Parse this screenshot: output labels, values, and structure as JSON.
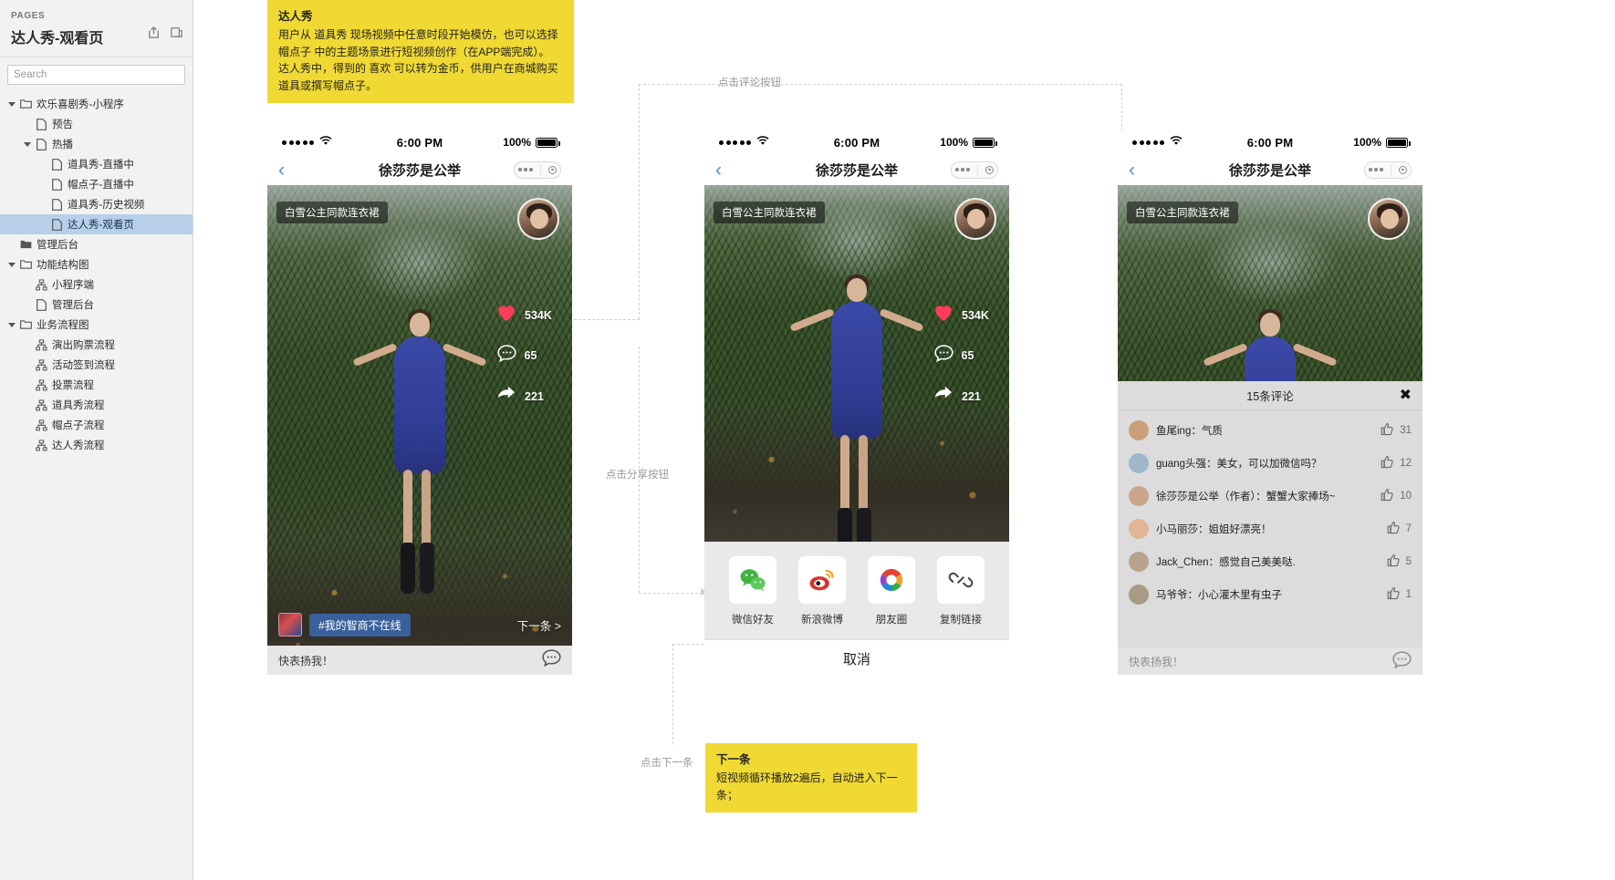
{
  "sidebar": {
    "pages_label": "PAGES",
    "title": "达人秀-观看页",
    "icons": [
      "share-icon",
      "duplicate-icon"
    ],
    "search_placeholder": "Search",
    "tree": [
      {
        "label": "欢乐喜剧秀-小程序",
        "depth": 0,
        "icon": "folder",
        "caret": "down",
        "selected": false
      },
      {
        "label": "预告",
        "depth": 1,
        "icon": "page",
        "caret": "none",
        "selected": false
      },
      {
        "label": "热播",
        "depth": 1,
        "icon": "page",
        "caret": "down",
        "selected": false
      },
      {
        "label": "道具秀-直播中",
        "depth": 2,
        "icon": "page",
        "caret": "none",
        "selected": false
      },
      {
        "label": "帽点子-直播中",
        "depth": 2,
        "icon": "page",
        "caret": "none",
        "selected": false
      },
      {
        "label": "道具秀-历史视频",
        "depth": 2,
        "icon": "page",
        "caret": "none",
        "selected": false
      },
      {
        "label": "达人秀-观看页",
        "depth": 2,
        "icon": "page",
        "caret": "none",
        "selected": true
      },
      {
        "label": "管理后台",
        "depth": 0,
        "icon": "folder-solid",
        "caret": "none",
        "selected": false
      },
      {
        "label": "功能结构图",
        "depth": 0,
        "icon": "folder",
        "caret": "down",
        "selected": false
      },
      {
        "label": "小程序端",
        "depth": 1,
        "icon": "flow",
        "caret": "none",
        "selected": false
      },
      {
        "label": "管理后台",
        "depth": 1,
        "icon": "page",
        "caret": "none",
        "selected": false
      },
      {
        "label": "业务流程图",
        "depth": 0,
        "icon": "folder",
        "caret": "down",
        "selected": false
      },
      {
        "label": "演出购票流程",
        "depth": 1,
        "icon": "flow",
        "caret": "none",
        "selected": false
      },
      {
        "label": "活动签到流程",
        "depth": 1,
        "icon": "flow",
        "caret": "none",
        "selected": false
      },
      {
        "label": "投票流程",
        "depth": 1,
        "icon": "flow",
        "caret": "none",
        "selected": false
      },
      {
        "label": "道具秀流程",
        "depth": 1,
        "icon": "flow",
        "caret": "none",
        "selected": false
      },
      {
        "label": "帽点子流程",
        "depth": 1,
        "icon": "flow",
        "caret": "none",
        "selected": false
      },
      {
        "label": "达人秀流程",
        "depth": 1,
        "icon": "flow",
        "caret": "none",
        "selected": false
      }
    ]
  },
  "notes": {
    "top": {
      "title": "达人秀",
      "body": "用户从 道具秀 现场视频中任意时段开始模仿，也可以选择 帽点子 中的主题场景进行短视频创作（在APP端完成）。\n达人秀中，得到的 喜欢 可以转为金币，供用户在商城购买道具或撰写帽点子。"
    },
    "bottom": {
      "title": "下一条",
      "body": "短视频循环播放2遍后，自动进入下一条；"
    }
  },
  "connectors": {
    "comment": "点击评论按钮",
    "share": "点击分享按钮",
    "next": "点击下一条"
  },
  "status_bar": {
    "time": "6:00 PM",
    "battery_pct": "100%",
    "signal_icon": "signal-dots-icon",
    "wifi_icon": "wifi-icon",
    "battery_icon": "battery-icon"
  },
  "nav": {
    "back_icon": "chevron-left-icon",
    "title": "徐莎莎是公举",
    "capsule_icon": "mini-program-capsule"
  },
  "video": {
    "product_tag": "白雪公主同款连衣裙",
    "avatar": "author-avatar",
    "actions": [
      {
        "icon": "heart-icon",
        "count": "534K",
        "name": "like-action"
      },
      {
        "icon": "comment-icon",
        "count": "65",
        "name": "comment-action"
      },
      {
        "icon": "share-icon",
        "count": "221",
        "name": "share-action"
      }
    ],
    "hashtag": "#我的智商不在线",
    "next_label": "下一条 >",
    "comment_placeholder": "快表扬我！",
    "comment_icon": "comment-bubble-icon"
  },
  "share_sheet": {
    "items": [
      {
        "label": "微信好友",
        "icon": "wechat-icon"
      },
      {
        "label": "新浪微博",
        "icon": "weibo-icon"
      },
      {
        "label": "朋友圈",
        "icon": "moments-icon"
      },
      {
        "label": "复制链接",
        "icon": "link-icon"
      }
    ],
    "cancel": "取消"
  },
  "comments_panel": {
    "header": "15条评论",
    "close_icon": "close-icon",
    "input_placeholder": "快表扬我！",
    "input_icon": "comment-bubble-icon",
    "list": [
      {
        "text": "鱼尾ing：气质",
        "likes": "31",
        "avatar_color": "#c9a07a"
      },
      {
        "text": "guang头强：美女，可以加微信吗？",
        "likes": "12",
        "avatar_color": "#9fb7c9"
      },
      {
        "text": "徐莎莎是公举（作者）：蟹蟹大家捧场~",
        "likes": "10",
        "avatar_color": "#caa58c"
      },
      {
        "text": "小马丽莎：姐姐好漂亮！",
        "likes": "7",
        "avatar_color": "#e0b694"
      },
      {
        "text": "Jack_Chen：感觉自己美美哒.",
        "likes": "5",
        "avatar_color": "#b9a28c"
      },
      {
        "text": "马爷爷：小心灌木里有虫子",
        "likes": "1",
        "avatar_color": "#a89a86"
      }
    ]
  },
  "colors": {
    "selection": "#b7cfe8",
    "note": "#f0d933",
    "accent_blue": "#4a90d9",
    "heart_red": "#ff3b5c"
  }
}
